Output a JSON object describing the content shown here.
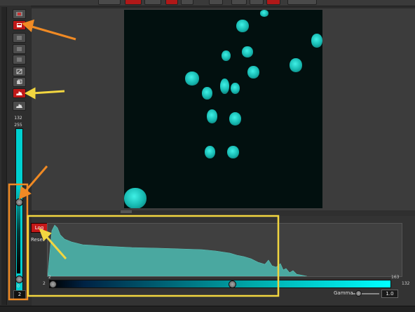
{
  "levels": {
    "top_value": "132",
    "max_label": "255",
    "min_label": "0",
    "bottom_value": "2"
  },
  "histogram": {
    "log_label": "Log",
    "reset_label": "Reset",
    "axis_min": "2",
    "axis_max": "163",
    "range_min": "2",
    "range_max": "132"
  },
  "gamma": {
    "label": "Gamma",
    "value": "1.0"
  },
  "colors": {
    "accent": "#00d4d4",
    "active_button": "#c41818",
    "annotation_orange": "#f08a24",
    "annotation_yellow": "#f2d640"
  },
  "icons": [
    "image-icon",
    "color-icon",
    "channel-icon",
    "channel-icon",
    "channel-icon",
    "crop-icon",
    "copy-icon",
    "histogram-icon",
    "histogram-outline-icon"
  ]
}
